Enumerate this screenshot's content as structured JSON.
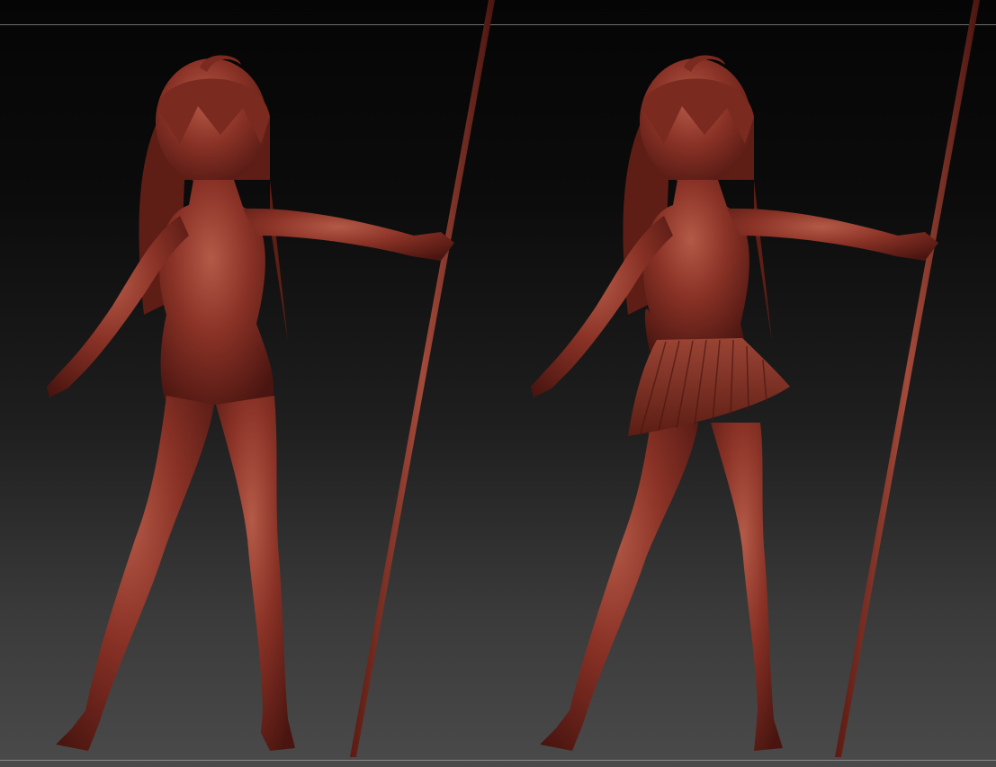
{
  "viewport": {
    "background": "#1a1a1a",
    "guide_color": "#6d6d6d"
  },
  "material": {
    "base": "#8a3226",
    "shadow": "#4a1510",
    "highlight": "#b45a48"
  },
  "models": [
    {
      "id": "figure-base",
      "variant": "nude-base-mesh",
      "prop": "staff"
    },
    {
      "id": "figure-skirt",
      "variant": "with-pleated-skirt",
      "prop": "staff"
    }
  ]
}
